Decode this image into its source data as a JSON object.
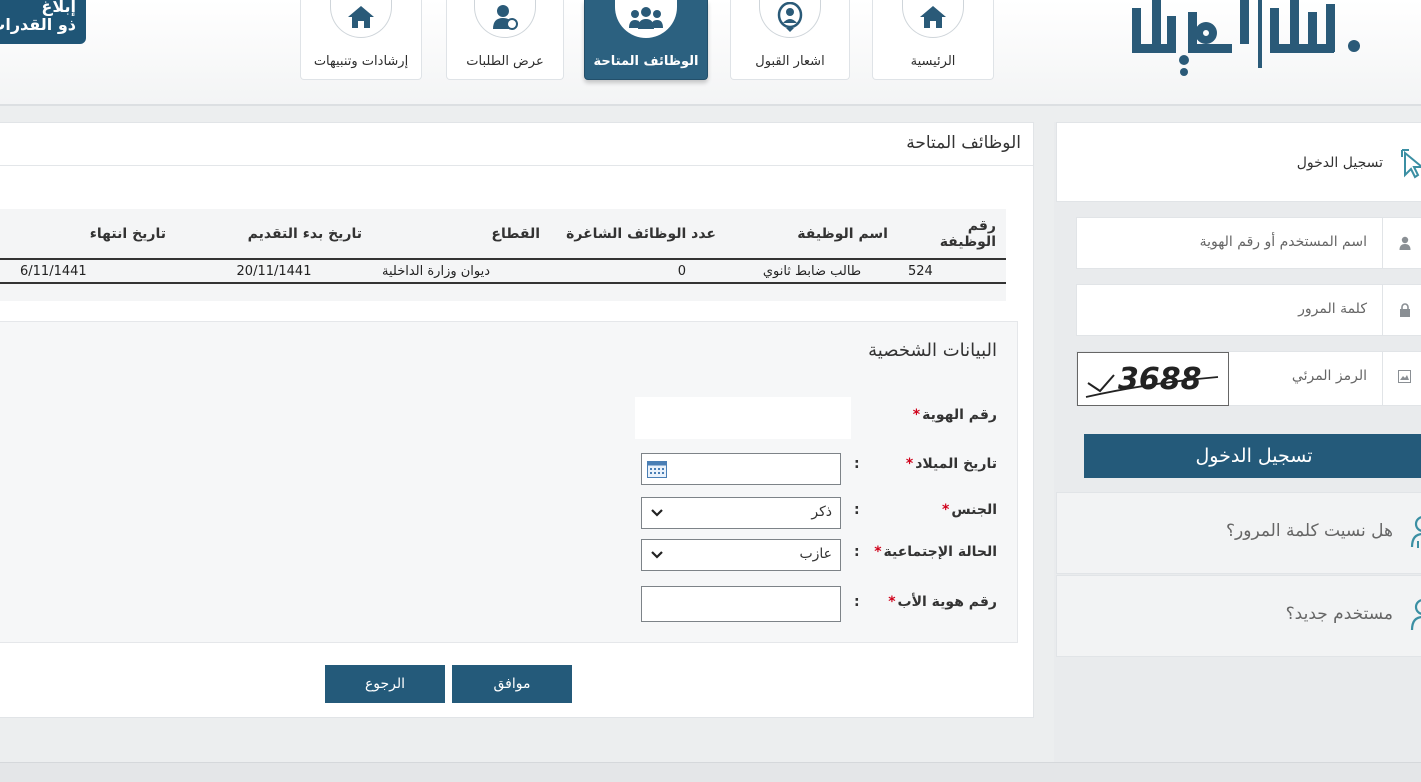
{
  "header": {
    "corner_badge": [
      "إبلاغ",
      "ذو القدرات"
    ],
    "nav": [
      {
        "label": "إرشادات وتنبيهات",
        "icon": "home-icon"
      },
      {
        "label": "عرض الطلبات",
        "icon": "user-request-icon"
      },
      {
        "label": "الوظائف المتاحة",
        "icon": "group-icon",
        "active": true
      },
      {
        "label": "اشعار القبول",
        "icon": "notice-icon"
      },
      {
        "label": "الرئيسية",
        "icon": "home-icon"
      }
    ]
  },
  "main": {
    "title": "الوظائف المتاحة",
    "table": {
      "headers": [
        "رقم الوظيفة",
        "اسم الوظيفة",
        "عدد الوظائف الشاغرة",
        "القطاع",
        "تاريخ بدء التقديم",
        "تاريخ انتهاء"
      ],
      "rows": [
        [
          "524",
          "طالب ضابط ثانوي",
          "0",
          "ديوان وزارة الداخلية",
          "20/11/1441",
          "6/11/1441"
        ]
      ]
    },
    "personal": {
      "title": "البيانات الشخصية",
      "id_label": "رقم الهوية",
      "dob_label": "تاريخ الميلاد",
      "gender_label": "الجنس",
      "gender_value": "ذكر",
      "marital_label": "الحالة الإجتماعية",
      "marital_value": "عازب",
      "father_id_label": "رقم هوية الأب",
      "required_mark": "*",
      "colon": ":"
    },
    "buttons": {
      "ok": "موافق",
      "back": "الرجوع"
    }
  },
  "sidebar": {
    "login_header": "تسجيل الدخول",
    "username_placeholder": "اسم المستخدم أو رقم الهوية",
    "password_placeholder": "كلمة المرور",
    "captcha_label": "الرمز المرئي",
    "captcha_value": "3688",
    "login_button": "تسجيل الدخول",
    "forgot_password": "هل نسيت كلمة المرور؟",
    "new_user": "مستخدم جديد؟"
  },
  "colors": {
    "primary": "#245a7a",
    "active_nav": "#2c6180",
    "required": "#d0021b"
  }
}
